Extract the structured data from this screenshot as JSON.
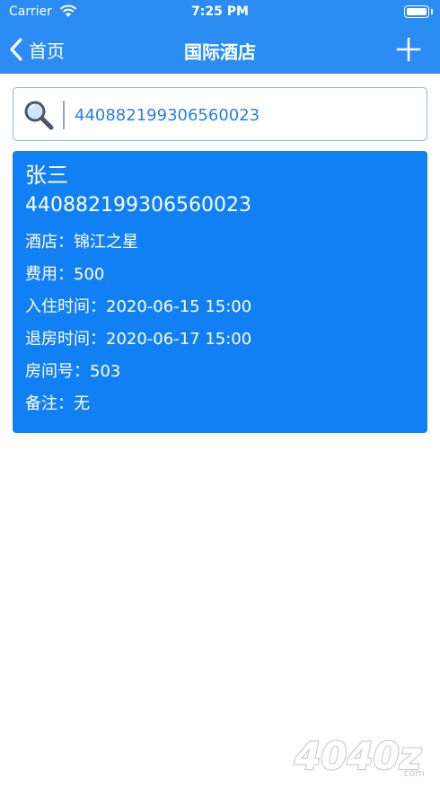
{
  "status_bar": {
    "carrier": "Carrier",
    "time": "7:25 PM"
  },
  "nav": {
    "back_label": "首页",
    "title": "国际酒店"
  },
  "search": {
    "value": "440882199306560023"
  },
  "record": {
    "name": "张三",
    "id_number": "440882199306560023",
    "hotel_label": "酒店：",
    "hotel": "锦江之星",
    "cost_label": "费用：",
    "cost": "500",
    "checkin_label": "入住时间：",
    "checkin": "2020-06-15 15:00",
    "checkout_label": "退房时间：",
    "checkout": "2020-06-17 15:00",
    "room_label": "房间号：",
    "room": "503",
    "note_label": "备注：",
    "note": "无"
  },
  "watermark": {
    "text": "4040z",
    "suffix": ".com"
  },
  "colors": {
    "bar": "#2b8cf3",
    "card": "#1280f5",
    "search_text": "#2a7de0"
  }
}
